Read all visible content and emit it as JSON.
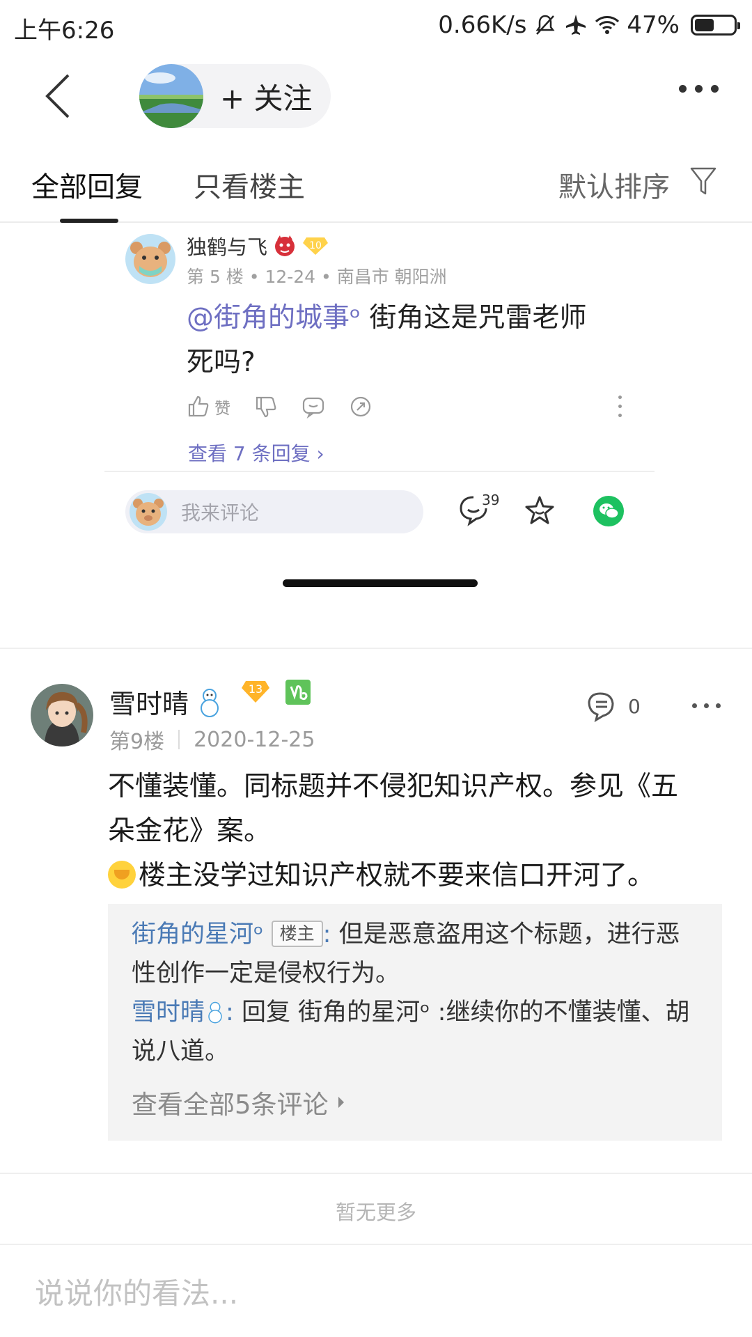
{
  "status_bar": {
    "time": "上午6:26",
    "speed": "0.66K/s",
    "battery": "47%"
  },
  "nav": {
    "follow_label": "+ 关注"
  },
  "tabs": {
    "all": "全部回复",
    "op_only": "只看楼主",
    "sort": "默认排序"
  },
  "floor5": {
    "name": "独鹤与飞",
    "level": "10",
    "meta": "第 5 楼 • 12-24 • 南昌市 朝阳洲",
    "mention": "@街角的城事ᵒ",
    "body_line1": " 街角这是咒雷老师",
    "body_line2": "死吗?",
    "like_label": "赞",
    "view_replies": "查看 7 条回复 ›"
  },
  "comment_bar": {
    "placeholder": "我来评论",
    "comment_count": "39"
  },
  "floor9": {
    "name": "雪时晴",
    "level": "13",
    "floor": "第9楼",
    "date": "2020-12-25",
    "like_count": "0",
    "body_line1": "不懂装懂。同标题并不侵犯知识产权。参见《五",
    "body_line2": "朵金花》案。",
    "body_line3": "楼主没学过知识产权就不要来信口开河了。",
    "sub_comments": [
      {
        "user": "街角的星河ᵒ",
        "tag": "楼主",
        "colon": ":",
        "text": " 但是恶意盗用这个标题，进行恶性创作一定是侵权行为。"
      },
      {
        "user": "雪时晴",
        "colon": ":",
        "text": " 回复 街角的星河ᵒ :继续你的不懂装懂、胡说八道。"
      }
    ],
    "view_all": "查看全部5条评论"
  },
  "footer": {
    "no_more": "暂无更多",
    "input_placeholder": "说说你的看法..."
  },
  "colors": {
    "mention": "#6e6fc2",
    "username_blue": "#4a7ab5",
    "wechat_green": "#1dc160"
  }
}
